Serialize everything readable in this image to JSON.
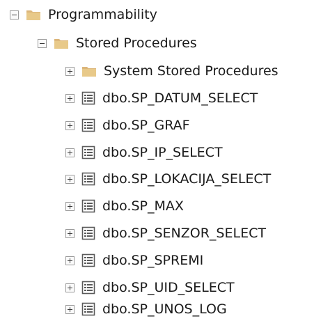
{
  "tree": {
    "programmability": {
      "label": "Programmability",
      "icon": "folder-icon",
      "state": "expanded"
    },
    "stored_procedures": {
      "label": "Stored Procedures",
      "icon": "folder-icon",
      "state": "expanded"
    },
    "system_stored_procedures": {
      "label": "System Stored Procedures",
      "icon": "folder-icon",
      "state": "collapsed"
    },
    "procedures": [
      {
        "label": "dbo.SP_DATUM_SELECT",
        "icon": "stored-procedure-icon",
        "state": "collapsed"
      },
      {
        "label": "dbo.SP_GRAF",
        "icon": "stored-procedure-icon",
        "state": "collapsed"
      },
      {
        "label": "dbo.SP_IP_SELECT",
        "icon": "stored-procedure-icon",
        "state": "collapsed"
      },
      {
        "label": "dbo.SP_LOKACIJA_SELECT",
        "icon": "stored-procedure-icon",
        "state": "collapsed"
      },
      {
        "label": "dbo.SP_MAX",
        "icon": "stored-procedure-icon",
        "state": "collapsed"
      },
      {
        "label": "dbo.SP_SENZOR_SELECT",
        "icon": "stored-procedure-icon",
        "state": "collapsed"
      },
      {
        "label": "dbo.SP_SPREMI",
        "icon": "stored-procedure-icon",
        "state": "collapsed"
      },
      {
        "label": "dbo.SP_UID_SELECT",
        "icon": "stored-procedure-icon",
        "state": "collapsed"
      },
      {
        "label": "dbo.SP_UNOS_LOG",
        "icon": "stored-procedure-icon",
        "state": "collapsed"
      }
    ]
  },
  "colors": {
    "folder": "#dcb67a",
    "folder_dark": "#c9a35e",
    "procedure_icon": "#5a5a5a",
    "text": "#1a1a1a"
  }
}
